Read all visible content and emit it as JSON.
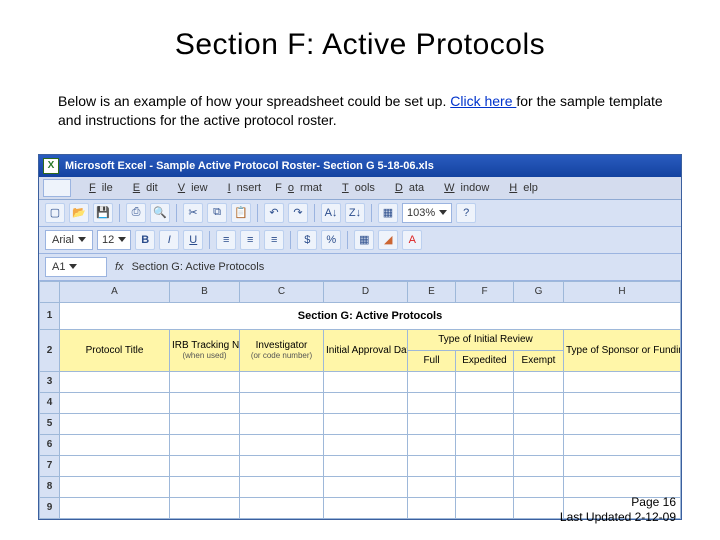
{
  "title": "Section F: Active Protocols",
  "intro_before_link": "Below is an example of how your spreadsheet could be set up. ",
  "intro_link": "Click here ",
  "intro_after_link": "for the sample template and instructions for the active protocol roster.",
  "excel": {
    "titlebar": "Microsoft Excel - Sample Active Protocol Roster- Section G 5-18-06.xls",
    "menus": [
      "File",
      "Edit",
      "View",
      "Insert",
      "Format",
      "Tools",
      "Data",
      "Window",
      "Help"
    ],
    "toolbar1": {
      "zoom": "103%"
    },
    "toolbar2": {
      "font": "Arial",
      "size": "12",
      "bold": "B",
      "italic": "I",
      "underline": "U"
    },
    "formula_ref": "A1",
    "formula_val": "Section G:  Active Protocols",
    "columns": [
      "A",
      "B",
      "C",
      "D",
      "E",
      "F",
      "G",
      "H"
    ],
    "row_nums": [
      1,
      2,
      3,
      4,
      5,
      6,
      7,
      8,
      9
    ],
    "section_banner": "Section G:  Active Protocols",
    "headers": {
      "protocol_title": "Protocol Title",
      "irb_tracking": "IRB Tracking Number",
      "irb_tracking_sub": "(when used)",
      "investigator": "Investigator",
      "investigator_sub": "(or code number)",
      "initial_approval": "Initial Approval Date",
      "type_initial_review": "Type of Initial Review",
      "tir_full": "Full",
      "tir_exp": "Expedited",
      "tir_exe": "Exempt",
      "type_sponsor": "Type of Sponsor or Funding Entity"
    }
  },
  "footer": {
    "page": "Page 16",
    "updated": "Last Updated 2-12-09"
  }
}
